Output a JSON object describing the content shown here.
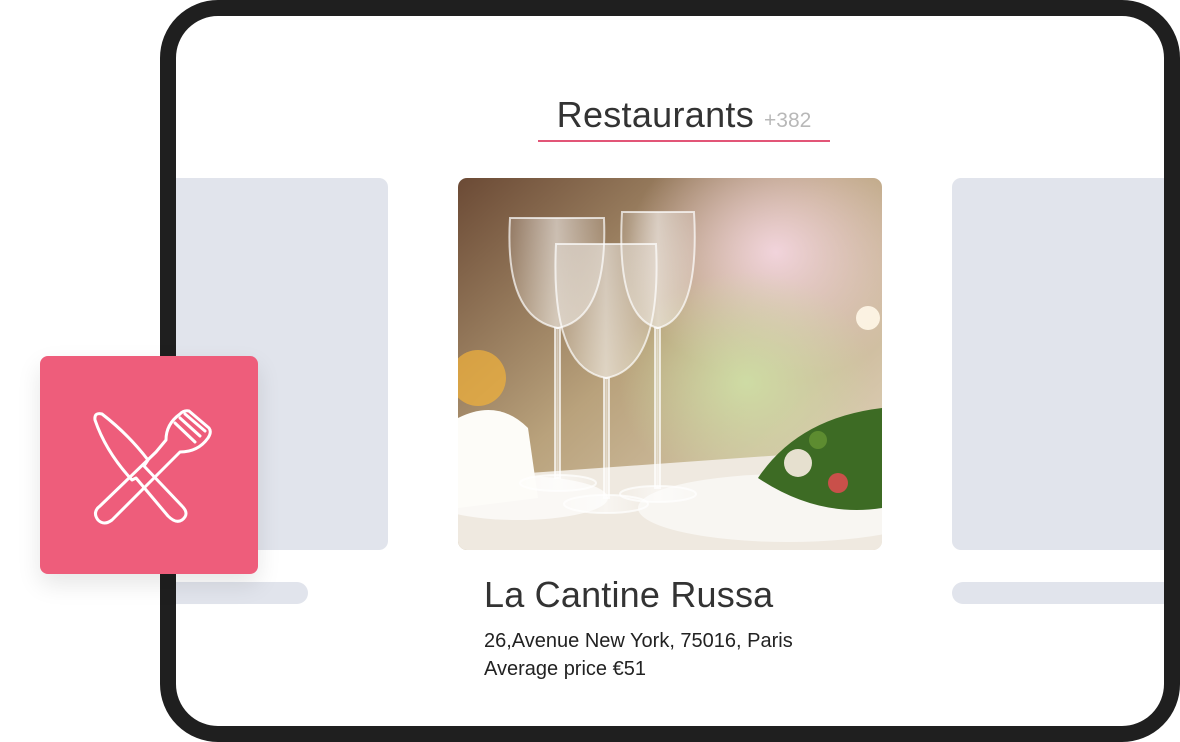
{
  "header": {
    "title": "Restaurants",
    "count": "+382"
  },
  "card": {
    "name": "La Cantine Russa",
    "address": "26,Avenue New York, 75016, Paris",
    "price": "Average price €51",
    "image": "restaurant-table-wine-glasses-photo"
  },
  "badge": {
    "icon": "fork-knife-icon",
    "color": "#ee5d7b"
  },
  "colors": {
    "accent": "#e25577",
    "placeholder": "#e1e4ec",
    "frame": "#1f1f1f"
  }
}
